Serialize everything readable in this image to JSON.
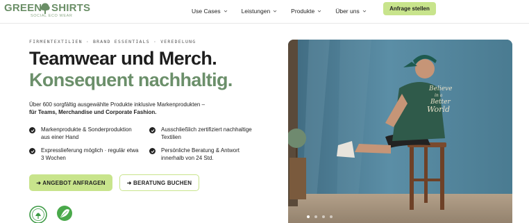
{
  "brand": {
    "word1": "GREEN",
    "word2": "SHIRTS",
    "tagline": "SOCIAL ECO WEAR",
    "color": "#6b8f67"
  },
  "nav": {
    "items": [
      {
        "label": "Use Cases",
        "icon": "chevron-down-icon"
      },
      {
        "label": "Leistungen",
        "icon": "chevron-down-icon"
      },
      {
        "label": "Produkte",
        "icon": "chevron-down-icon"
      },
      {
        "label": "Über uns",
        "icon": "chevron-down-icon"
      }
    ],
    "cta": "Anfrage stellen"
  },
  "hero": {
    "eyebrow": "FIRMENTEXTILIEN · BRAND ESSENTIALS · VEREDELUNG",
    "headline_1": "Teamwear und Merch.",
    "headline_2": "Konsequent nachhaltig.",
    "lead": "Über 600 sorgfältig ausgewählte Produkte inklusive Markenprodukten –",
    "lead_bold": "für Teams, Merchandise und Corporate Fashion.",
    "features": [
      {
        "icon": "check-circle-icon",
        "text": "Markenprodukte & Sonderproduktion aus einer Hand"
      },
      {
        "icon": "check-circle-icon",
        "text": "Ausschließlich zertifiziert nachhaltige Textilien"
      },
      {
        "icon": "check-circle-icon",
        "text": "Expresslieferung möglich · regulär etwa 3 Wochen"
      },
      {
        "icon": "check-circle-icon",
        "text": "Persönliche Beratung & Antwort innerhalb von 24 Std."
      }
    ],
    "primary_button": "➜ ANGEBOT ANFRAGEN",
    "secondary_button": "➜ BERATUNG BUCHEN",
    "shirt_print": [
      "Believe",
      "in a",
      "Better",
      "World"
    ]
  },
  "carousel": {
    "slide_count": 4,
    "active_index": 0
  },
  "colors": {
    "accent": "#c8e48c",
    "headline_green": "#6b8f6a",
    "backdrop_blue": "#4f7f95"
  }
}
